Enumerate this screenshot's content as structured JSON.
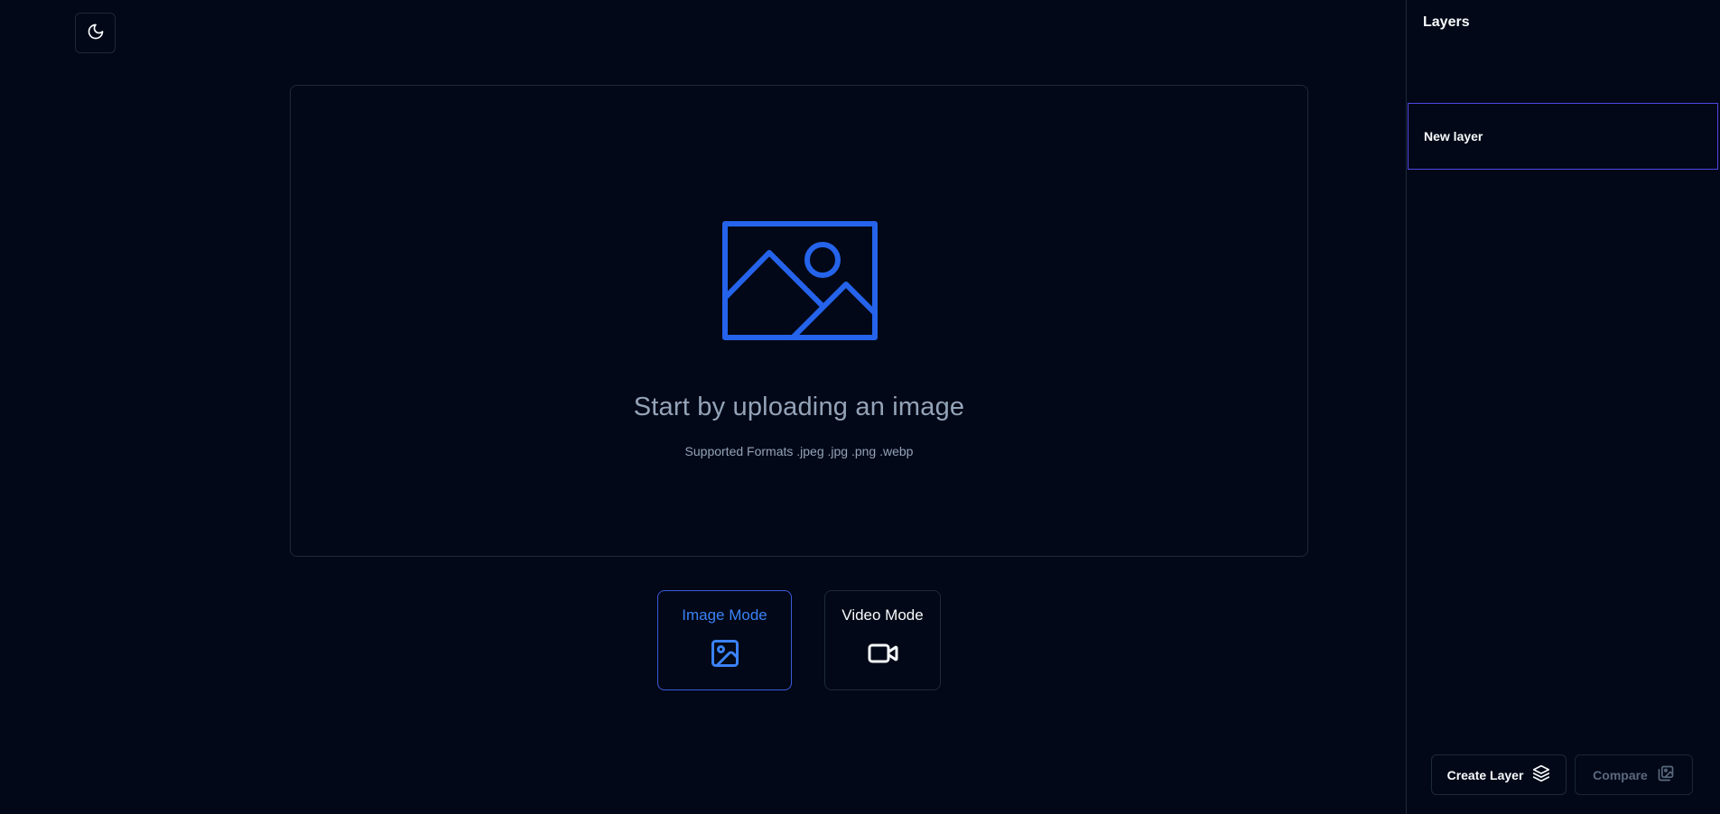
{
  "theme_toggle": {
    "icon": "moon-icon"
  },
  "upload": {
    "icon": "image-placeholder-icon",
    "title": "Start by uploading an image",
    "subtitle": "Supported Formats .jpeg .jpg .png .webp"
  },
  "modes": {
    "image": {
      "label": "Image Mode",
      "icon": "image-icon",
      "active": true
    },
    "video": {
      "label": "Video Mode",
      "icon": "video-camera-icon",
      "active": false
    }
  },
  "sidebar": {
    "title": "Layers",
    "layers": [
      {
        "label": "New layer",
        "selected": true
      }
    ],
    "create_button": {
      "label": "Create Layer",
      "icon": "layers-icon"
    },
    "compare_button": {
      "label": "Compare",
      "icon": "compare-image-icon",
      "disabled": true
    }
  },
  "colors": {
    "background": "#020817",
    "border": "#1e293b",
    "accent": "#3b82f6",
    "upload_icon": "#2563eb",
    "selected_border": "#4f46e5",
    "muted_text": "#94a3b8"
  }
}
